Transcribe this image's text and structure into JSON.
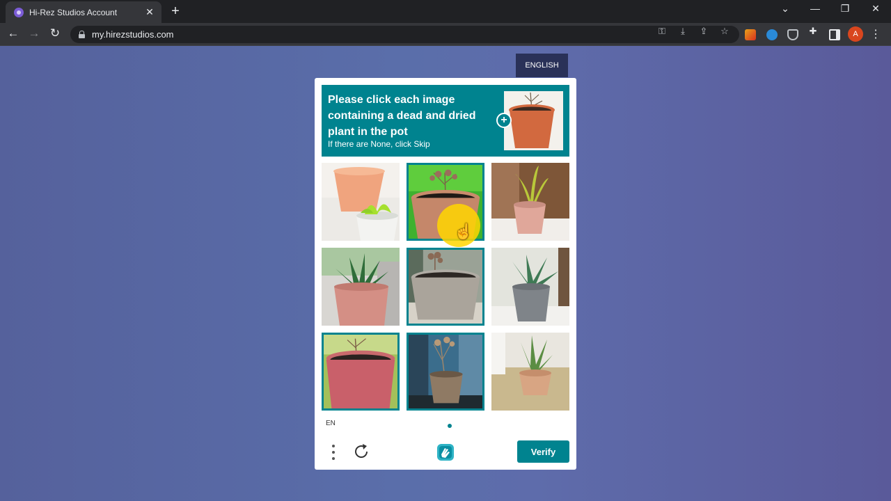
{
  "browser": {
    "tab_title": "Hi-Rez Studios Account",
    "tab_close": "✕",
    "new_tab": "+",
    "url": "my.hirezstudios.com",
    "profile_initial": "A",
    "window_controls": {
      "minimize": "—",
      "restore": "❐",
      "close": "✕",
      "tab_list": "⌄"
    },
    "nav": {
      "back": "←",
      "forward": "→",
      "reload": "↻"
    },
    "omnibox_icons": [
      "key-icon",
      "install-icon",
      "share-icon",
      "star-icon"
    ],
    "extensions": [
      "ext-1-icon",
      "ext-2-icon",
      "ext-3-icon",
      "puzzle-icon",
      "sidepanel-icon"
    ]
  },
  "page": {
    "language_button": "ENGLISH"
  },
  "captcha": {
    "prompt_title": "Please click each image containing a dead and dried plant in the pot",
    "prompt_subtitle": "If there are None, click Skip",
    "accent_color": "#00838f",
    "tiles": [
      {
        "description": "green plant in white pot",
        "selected": false
      },
      {
        "description": "dried plant in pot",
        "selected": true
      },
      {
        "description": "yellow-green plant in pink pot",
        "selected": false
      },
      {
        "description": "succulent in pink pot",
        "selected": false
      },
      {
        "description": "dried plant in grey pot",
        "selected": true
      },
      {
        "description": "succulent in grey pot",
        "selected": false
      },
      {
        "description": "dried plant in pink pot",
        "selected": true
      },
      {
        "description": "dried plant in brown pot",
        "selected": true
      },
      {
        "description": "aloe in tan pot",
        "selected": false
      }
    ],
    "language_code": "EN",
    "verify_label": "Verify"
  }
}
